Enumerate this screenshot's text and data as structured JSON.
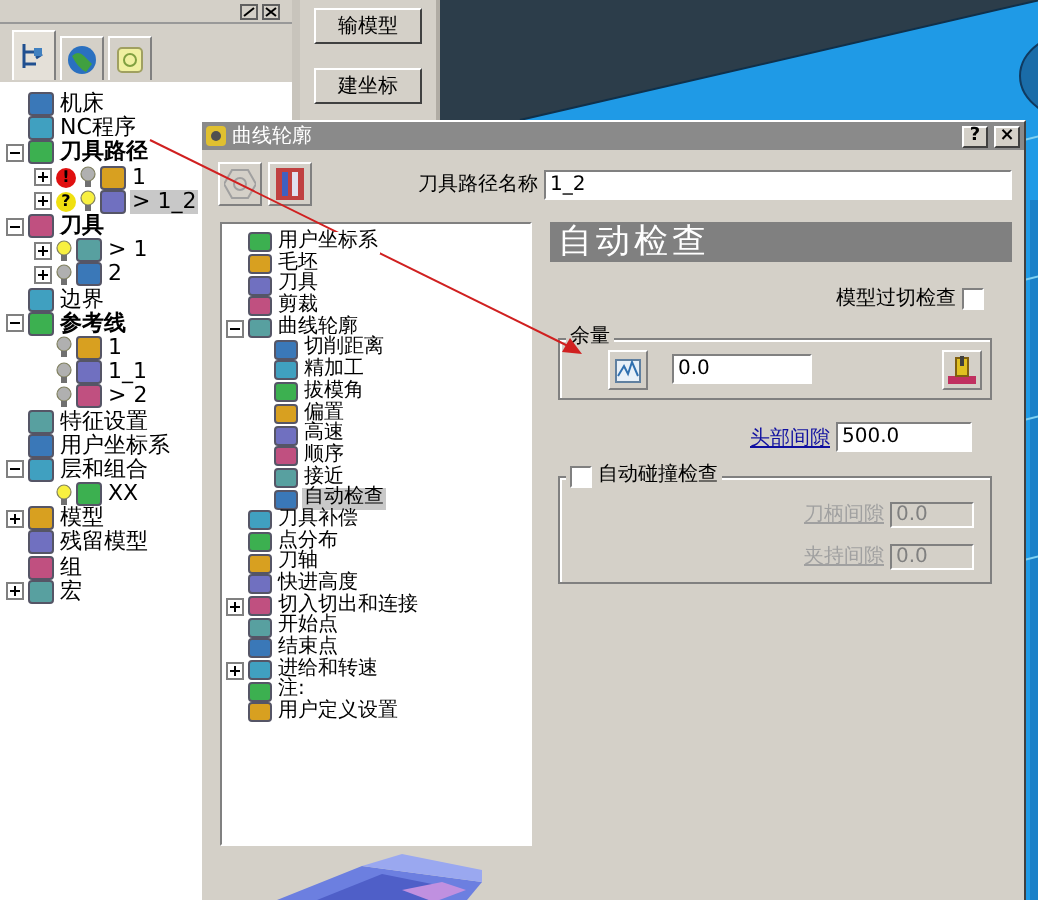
{
  "explorer": {
    "tabs": [
      {
        "selected": true
      },
      {
        "selected": false
      },
      {
        "selected": false
      }
    ],
    "tree": [
      {
        "kind": "entity",
        "label": "机床"
      },
      {
        "kind": "entity",
        "label": "NC程序"
      },
      {
        "kind": "category",
        "label": "刀具路径",
        "expanded": true,
        "children": [
          {
            "label": "1",
            "expanded": false,
            "badge": "!",
            "color": "#e01010",
            "active": false,
            "selected": false
          },
          {
            "label": "> 1_2",
            "expanded": false,
            "badge": "?",
            "color": "#f0e010",
            "active": true,
            "selected": true
          }
        ]
      },
      {
        "kind": "category",
        "label": "刀具",
        "expanded": true,
        "children": [
          {
            "label": "> 1",
            "expanded": false,
            "active": true
          },
          {
            "label": "2",
            "expanded": false,
            "active": false
          }
        ]
      },
      {
        "kind": "entity",
        "label": "边界"
      },
      {
        "kind": "category",
        "label": "参考线",
        "expanded": true,
        "children": [
          {
            "label": "1",
            "active": false
          },
          {
            "label": "1_1",
            "active": false
          },
          {
            "label": "> 2",
            "active": false
          }
        ]
      },
      {
        "kind": "entity",
        "label": "特征设置"
      },
      {
        "kind": "entity",
        "label": "用户坐标系"
      },
      {
        "kind": "entity",
        "label": "层和组合",
        "expanded": true,
        "children": [
          {
            "label": "XX",
            "active": true
          }
        ]
      },
      {
        "kind": "entity",
        "label": "模型",
        "expanded": false
      },
      {
        "kind": "entity",
        "label": "残留模型"
      },
      {
        "kind": "entity",
        "label": "组"
      },
      {
        "kind": "entity",
        "label": "宏",
        "expanded": false
      }
    ]
  },
  "side_buttons": [
    "输模型",
    "建坐标"
  ],
  "dialog": {
    "title": "曲线轮廓",
    "title_buttons": [
      "?",
      "×"
    ],
    "name_label": "刀具路径名称",
    "name_value": "1_2",
    "tree": [
      {
        "label": "用户坐标系",
        "selected": false
      },
      {
        "label": "毛坯",
        "selected": false
      },
      {
        "label": "刀具",
        "selected": false
      },
      {
        "label": "剪裁",
        "selected": false
      },
      {
        "label": "曲线轮廓",
        "selected": false,
        "expanded": true,
        "children": [
          {
            "label": "切削距离",
            "selected": false
          },
          {
            "label": "精加工",
            "selected": false
          },
          {
            "label": "拔模角",
            "selected": false
          },
          {
            "label": "偏置",
            "selected": false
          },
          {
            "label": "高速",
            "selected": false
          },
          {
            "label": "顺序",
            "selected": false
          },
          {
            "label": "接近",
            "selected": false
          },
          {
            "label": "自动检查",
            "selected": true
          }
        ]
      },
      {
        "label": "刀具补偿",
        "selected": false
      },
      {
        "label": "点分布",
        "selected": false
      },
      {
        "label": "刀轴",
        "selected": false
      },
      {
        "label": "快进高度",
        "selected": false
      },
      {
        "label": "切入切出和连接",
        "selected": false,
        "expanded": false
      },
      {
        "label": "开始点",
        "selected": false
      },
      {
        "label": "结束点",
        "selected": false
      },
      {
        "label": "进给和转速",
        "selected": false,
        "expanded": false
      },
      {
        "label": "注:",
        "selected": false
      },
      {
        "label": "用户定义设置",
        "selected": false
      }
    ],
    "page_title": "自动检查",
    "gouge_check": {
      "label": "模型过切检查",
      "checked": false
    },
    "thickness": {
      "legend": "余量",
      "value": "0.0"
    },
    "head_clearance": {
      "label": "头部间隙",
      "value": "500.0"
    },
    "collision": {
      "label": "自动碰撞检查",
      "checked": false,
      "fields": [
        {
          "label": "刀柄间隙",
          "value": "0.0",
          "disabled": true
        },
        {
          "label": "夹持间隙",
          "value": "0.0",
          "disabled": true
        }
      ]
    }
  }
}
